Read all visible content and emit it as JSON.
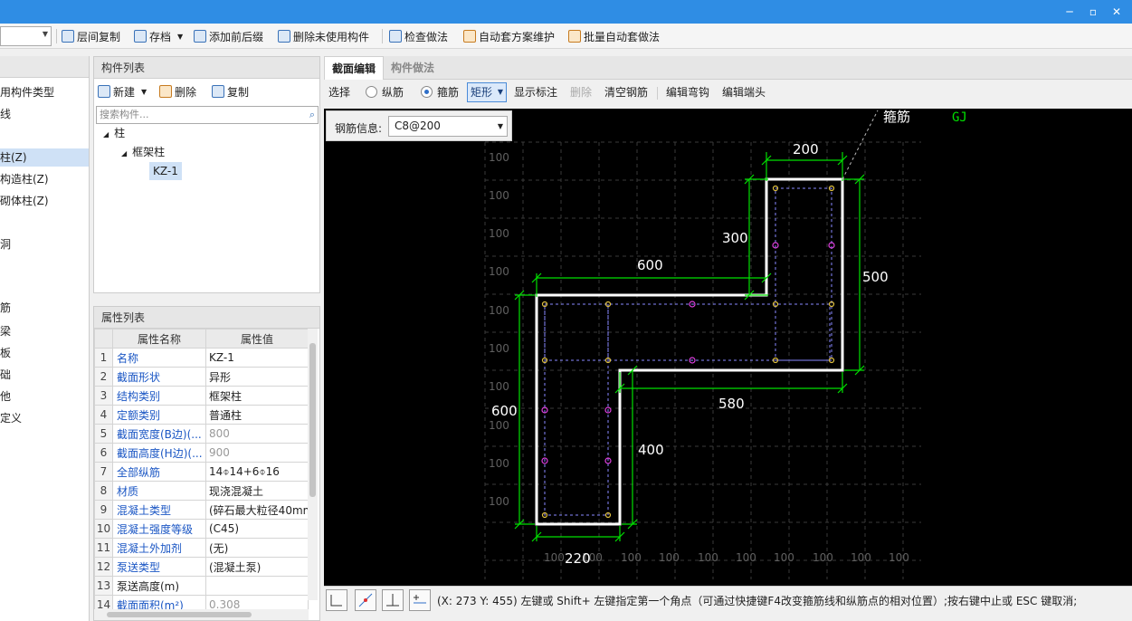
{
  "toolbar": {
    "items": [
      "层间复制",
      "存档",
      "添加前后缀",
      "删除未使用构件",
      "检查做法",
      "自动套方案维护",
      "批量自动套做法"
    ]
  },
  "left_tree": {
    "items": [
      "用构件类型",
      "线",
      "柱(Z)",
      "构造柱(Z)",
      "砌体柱(Z)",
      "洞",
      "筋",
      "梁",
      "板",
      "础",
      "他",
      "定义"
    ]
  },
  "component_list": {
    "title": "构件列表",
    "new_label": "新建",
    "delete_label": "删除",
    "copy_label": "复制",
    "search_placeholder": "搜索构件...",
    "tree": {
      "root": "柱",
      "child": "框架柱",
      "leaf": "KZ-1"
    }
  },
  "properties": {
    "title": "属性列表",
    "col_name": "属性名称",
    "col_value": "属性值",
    "rows": [
      {
        "n": "1",
        "name": "名称",
        "value": "KZ-1"
      },
      {
        "n": "2",
        "name": "截面形状",
        "value": "异形"
      },
      {
        "n": "3",
        "name": "结构类别",
        "value": "框架柱"
      },
      {
        "n": "4",
        "name": "定额类别",
        "value": "普通柱"
      },
      {
        "n": "5",
        "name": "截面宽度(B边)(...",
        "value": "800"
      },
      {
        "n": "6",
        "name": "截面高度(H边)(...",
        "value": "900"
      },
      {
        "n": "7",
        "name": "全部纵筋",
        "value": "14⌽14+6⌽16"
      },
      {
        "n": "8",
        "name": "材质",
        "value": "现浇混凝土"
      },
      {
        "n": "9",
        "name": "混凝土类型",
        "value": "(碎石最大粒径40mm"
      },
      {
        "n": "10",
        "name": "混凝土强度等级",
        "value": "(C45)"
      },
      {
        "n": "11",
        "name": "混凝土外加剂",
        "value": "(无)"
      },
      {
        "n": "12",
        "name": "泵送类型",
        "value": "(混凝土泵)"
      },
      {
        "n": "13",
        "name": "泵送高度(m)",
        "value": ""
      },
      {
        "n": "14",
        "name": "截面面积(m²)",
        "value": "0.308"
      }
    ]
  },
  "editor": {
    "tab_active": "截面编辑",
    "tab_inactive": "构件做法",
    "select_label": "选择",
    "radio_long": "纵筋",
    "radio_stirrup": "箍筋",
    "shape_select": "矩形",
    "show_label": "显示标注",
    "delete_label": "删除",
    "clear_label": "清空钢筋",
    "edit_hook": "编辑弯钩",
    "edit_end": "编辑端头",
    "rebar_info_label": "钢筋信息:",
    "rebar_info_value": "C8@200"
  },
  "drawing": {
    "stirrup_label": "箍筋",
    "gj_label": "GJ",
    "grid_label": "100",
    "dims": {
      "top_width": "200",
      "top_height": "300",
      "mid_width": "600",
      "right_height": "500",
      "inner_width": "580",
      "left_height": "600",
      "leg_height": "400",
      "bottom_width": "220"
    }
  },
  "status": {
    "text": "(X: 273 Y: 455)  左键或 Shift+ 左键指定第一个角点（可通过快捷键F4改变箍筋线和纵筋点的相对位置）;按右键中止或 ESC 键取消;"
  },
  "colors": {
    "titlebar": "#2f8de4",
    "dimension": "#00e000",
    "outline": "#ffffff",
    "rebar_pink": "#e040e0",
    "rebar_yellow": "#e0c040"
  }
}
